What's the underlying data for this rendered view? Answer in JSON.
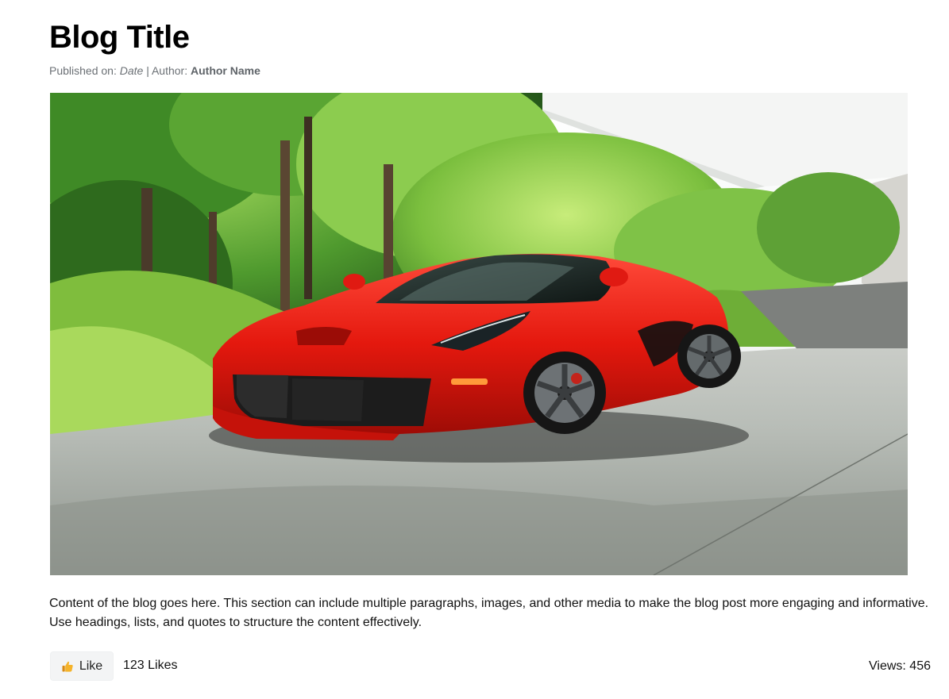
{
  "post": {
    "title": "Blog Title",
    "meta": {
      "published_label": "Published on:",
      "date": "Date",
      "separator": "|",
      "author_label": "Author:",
      "author_name": "Author Name"
    },
    "hero_image": {
      "subject": "red sports car parked on a concrete driveway with green trees"
    },
    "content": "Content of the blog goes here. This section can include multiple paragraphs, images, and other media to make the blog post more engaging and informative. Use headings, lists, and quotes to structure the content effectively.",
    "footer": {
      "like_icon": "thumbs-up-icon",
      "like_label": "Like",
      "likes_text": "123 Likes",
      "views_text": "Views: 456"
    }
  },
  "colors": {
    "text": "#111111",
    "meta": "#6b7075",
    "like_button_bg": "#f3f4f5",
    "car_red": "#e01a12"
  }
}
